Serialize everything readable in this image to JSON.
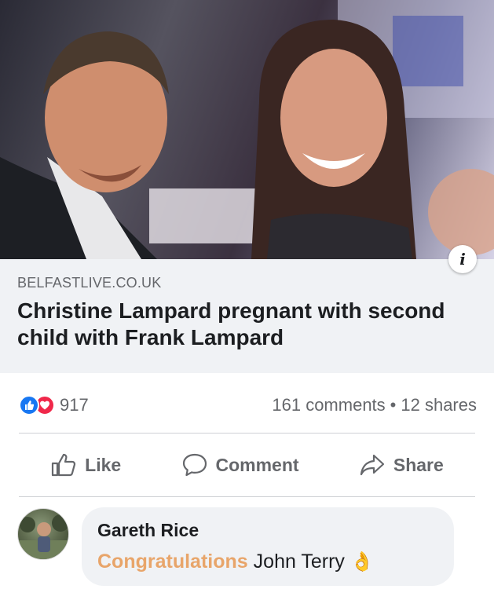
{
  "post": {
    "info_icon": "i",
    "source": "BELFASTLIVE.CO.UK",
    "headline": "Christine Lampard pregnant with second child with Frank Lampard"
  },
  "stats": {
    "reaction_count": "917",
    "comments": "161 comments",
    "separator": "•",
    "shares": "12 shares",
    "reactions": [
      "like-icon",
      "love-icon"
    ]
  },
  "actions": {
    "like": "Like",
    "comment": "Comment",
    "share": "Share"
  },
  "comment": {
    "author": "Gareth Rice",
    "highlight": "Congratulations",
    "text": "John Terry",
    "emoji": "👌"
  },
  "colors": {
    "link_bg": "#f0f2f5",
    "like_blue": "#1877f2",
    "love_red": "#f0284a",
    "muted": "#65676b",
    "highlight": "#e8a56a"
  }
}
